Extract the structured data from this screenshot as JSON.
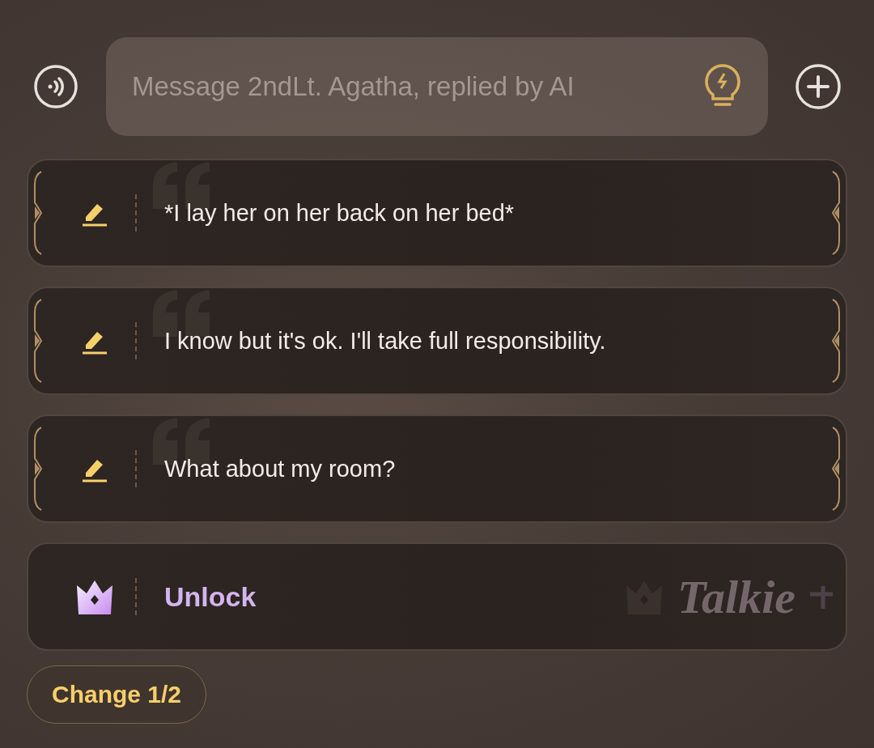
{
  "composer": {
    "placeholder": "Message 2ndLt. Agatha, replied by AI"
  },
  "suggestions": [
    {
      "kind": "reply",
      "text": "*I lay her on her back on her bed*"
    },
    {
      "kind": "reply",
      "text": "I know but it's ok. I'll take full responsibility."
    },
    {
      "kind": "reply",
      "text": "What about my room?"
    },
    {
      "kind": "unlock",
      "text": "Unlock",
      "logo": "Talkie"
    }
  ],
  "change_button": {
    "label": "Change 1/2"
  }
}
